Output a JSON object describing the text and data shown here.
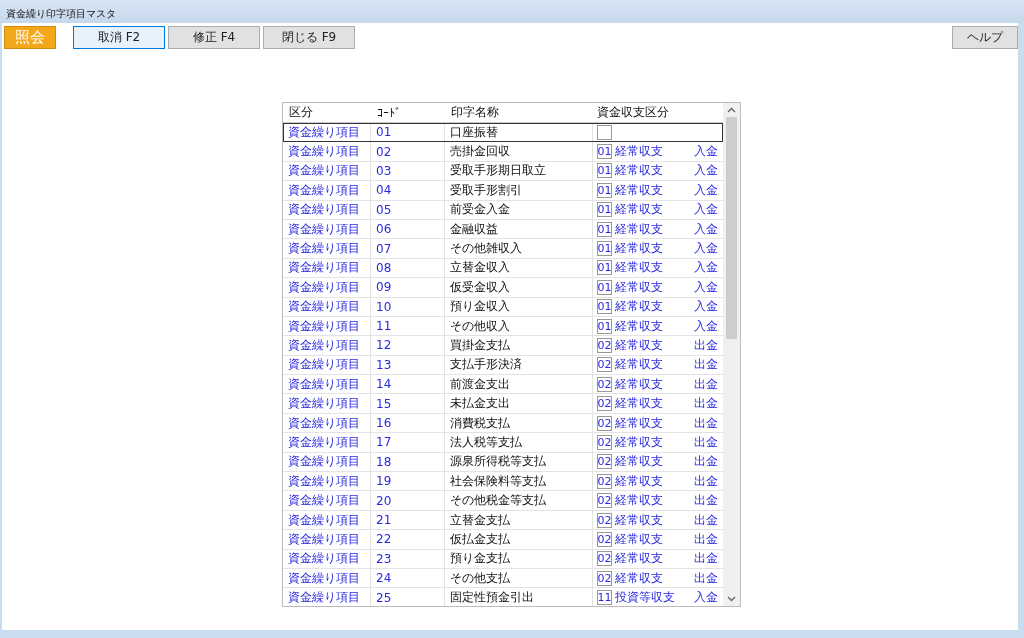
{
  "window": {
    "title": "資金繰り印字項目マスタ"
  },
  "mode_badge": "照会",
  "toolbar": [
    {
      "label": "取消 F2",
      "selected": true
    },
    {
      "label": "修正 F4",
      "selected": false
    },
    {
      "label": "閉じる F9",
      "selected": false
    }
  ],
  "help_button": "ヘルプ",
  "table": {
    "columns": [
      "区分",
      "ｺｰﾄﾞ",
      "印字名称",
      "資金収支区分"
    ],
    "rows": [
      {
        "category": "資金繰り項目",
        "code": "01",
        "name": "口座振替",
        "selected": true
      },
      {
        "category": "資金繰り項目",
        "code": "02",
        "name": "売掛金回収",
        "fund_code": "01",
        "fund_class": "経常収支",
        "direction": "入金",
        "selected": false
      },
      {
        "category": "資金繰り項目",
        "code": "03",
        "name": "受取手形期日取立",
        "fund_code": "01",
        "fund_class": "経常収支",
        "direction": "入金",
        "selected": false
      },
      {
        "category": "資金繰り項目",
        "code": "04",
        "name": "受取手形割引",
        "fund_code": "01",
        "fund_class": "経常収支",
        "direction": "入金",
        "selected": false
      },
      {
        "category": "資金繰り項目",
        "code": "05",
        "name": "前受金入金",
        "fund_code": "01",
        "fund_class": "経常収支",
        "direction": "入金",
        "selected": false
      },
      {
        "category": "資金繰り項目",
        "code": "06",
        "name": "金融収益",
        "fund_code": "01",
        "fund_class": "経常収支",
        "direction": "入金",
        "selected": false
      },
      {
        "category": "資金繰り項目",
        "code": "07",
        "name": "その他雑収入",
        "fund_code": "01",
        "fund_class": "経常収支",
        "direction": "入金",
        "selected": false
      },
      {
        "category": "資金繰り項目",
        "code": "08",
        "name": "立替金収入",
        "fund_code": "01",
        "fund_class": "経常収支",
        "direction": "入金",
        "selected": false
      },
      {
        "category": "資金繰り項目",
        "code": "09",
        "name": "仮受金収入",
        "fund_code": "01",
        "fund_class": "経常収支",
        "direction": "入金",
        "selected": false
      },
      {
        "category": "資金繰り項目",
        "code": "10",
        "name": "預り金収入",
        "fund_code": "01",
        "fund_class": "経常収支",
        "direction": "入金",
        "selected": false
      },
      {
        "category": "資金繰り項目",
        "code": "11",
        "name": "その他収入",
        "fund_code": "01",
        "fund_class": "経常収支",
        "direction": "入金",
        "selected": false
      },
      {
        "category": "資金繰り項目",
        "code": "12",
        "name": "買掛金支払",
        "fund_code": "02",
        "fund_class": "経常収支",
        "direction": "出金",
        "selected": false
      },
      {
        "category": "資金繰り項目",
        "code": "13",
        "name": "支払手形決済",
        "fund_code": "02",
        "fund_class": "経常収支",
        "direction": "出金",
        "selected": false
      },
      {
        "category": "資金繰り項目",
        "code": "14",
        "name": "前渡金支出",
        "fund_code": "02",
        "fund_class": "経常収支",
        "direction": "出金",
        "selected": false
      },
      {
        "category": "資金繰り項目",
        "code": "15",
        "name": "未払金支出",
        "fund_code": "02",
        "fund_class": "経常収支",
        "direction": "出金",
        "selected": false
      },
      {
        "category": "資金繰り項目",
        "code": "16",
        "name": "消費税支払",
        "fund_code": "02",
        "fund_class": "経常収支",
        "direction": "出金",
        "selected": false
      },
      {
        "category": "資金繰り項目",
        "code": "17",
        "name": "法人税等支払",
        "fund_code": "02",
        "fund_class": "経常収支",
        "direction": "出金",
        "selected": false
      },
      {
        "category": "資金繰り項目",
        "code": "18",
        "name": "源泉所得税等支払",
        "fund_code": "02",
        "fund_class": "経常収支",
        "direction": "出金",
        "selected": false
      },
      {
        "category": "資金繰り項目",
        "code": "19",
        "name": "社会保険料等支払",
        "fund_code": "02",
        "fund_class": "経常収支",
        "direction": "出金",
        "selected": false
      },
      {
        "category": "資金繰り項目",
        "code": "20",
        "name": "その他税金等支払",
        "fund_code": "02",
        "fund_class": "経常収支",
        "direction": "出金",
        "selected": false
      },
      {
        "category": "資金繰り項目",
        "code": "21",
        "name": "立替金支払",
        "fund_code": "02",
        "fund_class": "経常収支",
        "direction": "出金",
        "selected": false
      },
      {
        "category": "資金繰り項目",
        "code": "22",
        "name": "仮払金支払",
        "fund_code": "02",
        "fund_class": "経常収支",
        "direction": "出金",
        "selected": false
      },
      {
        "category": "資金繰り項目",
        "code": "23",
        "name": "預り金支払",
        "fund_code": "02",
        "fund_class": "経常収支",
        "direction": "出金",
        "selected": false
      },
      {
        "category": "資金繰り項目",
        "code": "24",
        "name": "その他支払",
        "fund_code": "02",
        "fund_class": "経常収支",
        "direction": "出金",
        "selected": false
      },
      {
        "category": "資金繰り項目",
        "code": "25",
        "name": "固定性預金引出",
        "fund_code": "11",
        "fund_class": "投資等収支",
        "direction": "入金",
        "selected": false
      }
    ]
  }
}
